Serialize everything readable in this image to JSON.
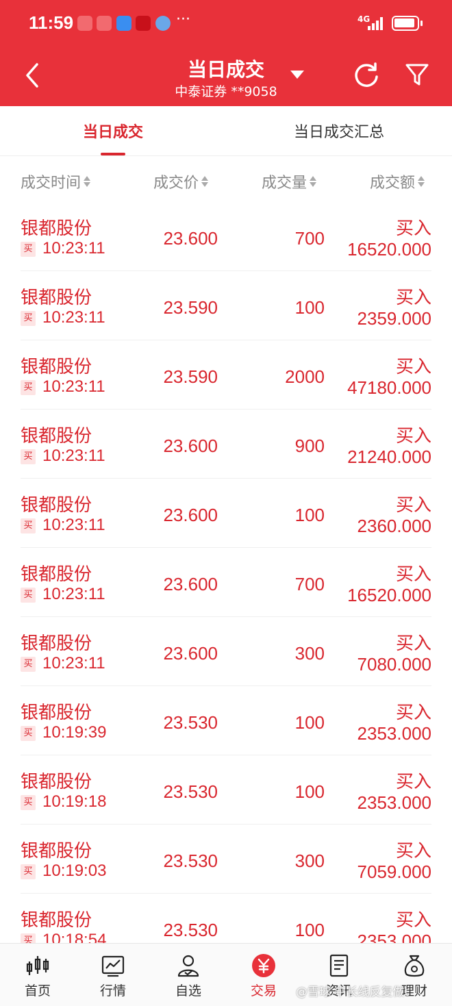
{
  "status_bar": {
    "time": "11:59",
    "network": "4G",
    "more": "···"
  },
  "header": {
    "title": "当日成交",
    "subtitle": "中泰证券 **9058"
  },
  "tabs": [
    {
      "label": "当日成交",
      "active": true
    },
    {
      "label": "当日成交汇总",
      "active": false
    }
  ],
  "columns": [
    "成交时间",
    "成交价",
    "成交量",
    "成交额"
  ],
  "trades": [
    {
      "name": "银都股份",
      "tag": "买",
      "time": "10:23:11",
      "price": "23.600",
      "qty": "700",
      "direction": "买入",
      "amount": "16520.000"
    },
    {
      "name": "银都股份",
      "tag": "买",
      "time": "10:23:11",
      "price": "23.590",
      "qty": "100",
      "direction": "买入",
      "amount": "2359.000"
    },
    {
      "name": "银都股份",
      "tag": "买",
      "time": "10:23:11",
      "price": "23.590",
      "qty": "2000",
      "direction": "买入",
      "amount": "47180.000"
    },
    {
      "name": "银都股份",
      "tag": "买",
      "time": "10:23:11",
      "price": "23.600",
      "qty": "900",
      "direction": "买入",
      "amount": "21240.000"
    },
    {
      "name": "银都股份",
      "tag": "买",
      "time": "10:23:11",
      "price": "23.600",
      "qty": "100",
      "direction": "买入",
      "amount": "2360.000"
    },
    {
      "name": "银都股份",
      "tag": "买",
      "time": "10:23:11",
      "price": "23.600",
      "qty": "700",
      "direction": "买入",
      "amount": "16520.000"
    },
    {
      "name": "银都股份",
      "tag": "买",
      "time": "10:23:11",
      "price": "23.600",
      "qty": "300",
      "direction": "买入",
      "amount": "7080.000"
    },
    {
      "name": "银都股份",
      "tag": "买",
      "time": "10:19:39",
      "price": "23.530",
      "qty": "100",
      "direction": "买入",
      "amount": "2353.000"
    },
    {
      "name": "银都股份",
      "tag": "买",
      "time": "10:19:18",
      "price": "23.530",
      "qty": "100",
      "direction": "买入",
      "amount": "2353.000"
    },
    {
      "name": "银都股份",
      "tag": "买",
      "time": "10:19:03",
      "price": "23.530",
      "qty": "300",
      "direction": "买入",
      "amount": "7059.000"
    },
    {
      "name": "银都股份",
      "tag": "买",
      "time": "10:18:54",
      "price": "23.530",
      "qty": "100",
      "direction": "买入",
      "amount": "2353.000"
    }
  ],
  "bottom_nav": [
    {
      "label": "首页",
      "icon": "candlestick-icon",
      "active": false
    },
    {
      "label": "行情",
      "icon": "chart-icon",
      "active": false
    },
    {
      "label": "自选",
      "icon": "user-icon",
      "active": false
    },
    {
      "label": "交易",
      "icon": "yuan-icon",
      "active": true
    },
    {
      "label": "资讯",
      "icon": "document-icon",
      "active": false
    },
    {
      "label": "理财",
      "icon": "money-bag-icon",
      "active": false
    }
  ],
  "watermark": "@雪球 中长线反复做t",
  "colors": {
    "brand_red": "#e8313a",
    "text_red": "#d9262e",
    "tag_bg": "#fde4e4"
  }
}
